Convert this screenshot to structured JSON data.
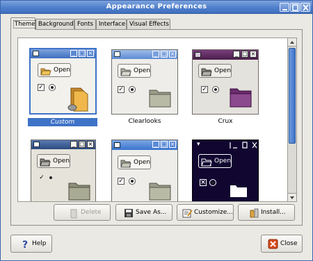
{
  "window": {
    "title": "Appearance Preferences"
  },
  "tabs": [
    {
      "label": "Theme",
      "active": true
    },
    {
      "label": "Background"
    },
    {
      "label": "Fonts"
    },
    {
      "label": "Interface"
    },
    {
      "label": "Visual Effects"
    }
  ],
  "themes": [
    {
      "name": "Custom",
      "open_label": "Open",
      "selected": true
    },
    {
      "name": "Clearlooks",
      "open_label": "Open"
    },
    {
      "name": "Crux",
      "open_label": "Open"
    },
    {
      "name": "",
      "open_label": "Open"
    },
    {
      "name": "",
      "open_label": "Open"
    },
    {
      "name": "",
      "open_label": "Open"
    }
  ],
  "actions": {
    "delete_label": "Delete",
    "save_label": "Save As...",
    "customize_label": "Customize...",
    "install_label": "Install..."
  },
  "footer": {
    "help_label": "Help",
    "close_label": "Close"
  },
  "colors": {
    "titlebar": "#4f7fcb",
    "selection": "#3f73c7",
    "crux": "#5c2d5e",
    "dark_theme": "#100630"
  }
}
